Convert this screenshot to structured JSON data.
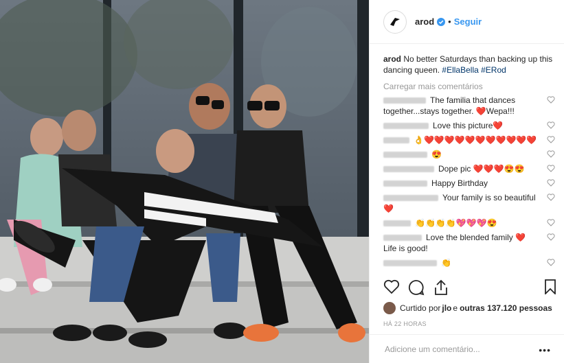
{
  "post": {
    "username": "arod",
    "follow_label": "Seguir",
    "separator": "•"
  },
  "caption": {
    "username": "arod",
    "text": "No better Saturdays than backing up this dancing queen.",
    "hashtags": "#EllaBella #ERod"
  },
  "load_more": "Carregar mais comentários",
  "comments": [
    {
      "text": "The familia that dances together...stays together. ",
      "emoji": "❤️",
      "suffix": "Wepa!!!"
    },
    {
      "text": "Love this picture",
      "emoji": "❤️",
      "suffix": ""
    },
    {
      "text": "",
      "emoji": "👌❤️❤️❤️❤️❤️❤️❤️❤️❤️❤️❤️",
      "suffix": ""
    },
    {
      "text": "",
      "emoji": "😍",
      "suffix": ""
    },
    {
      "text": "Dope pic ",
      "emoji": "❤️❤️❤️😍😍",
      "suffix": ""
    },
    {
      "text": "Happy Birthday",
      "emoji": "",
      "suffix": ""
    },
    {
      "text": "Your family is so beautiful ",
      "emoji": "❤️",
      "suffix": ""
    },
    {
      "text": "",
      "emoji": "👏👏👏👏💖💖💖😍",
      "suffix": ""
    },
    {
      "text": "Love the blended family ",
      "emoji": "❤️",
      "suffix": " Life is good!"
    },
    {
      "text": "",
      "emoji": "👏",
      "suffix": ""
    }
  ],
  "likes": {
    "prefix": "Curtido por ",
    "user": "jlo",
    "middle": " e ",
    "others": "outras 137.120 pessoas"
  },
  "timestamp": "HÁ 22 HORAS",
  "add_comment_placeholder": "Adicione um comentário...",
  "more_options": "•••",
  "colors": {
    "link": "#3897f0",
    "hashtag": "#003569",
    "heart": "#c0171b"
  }
}
